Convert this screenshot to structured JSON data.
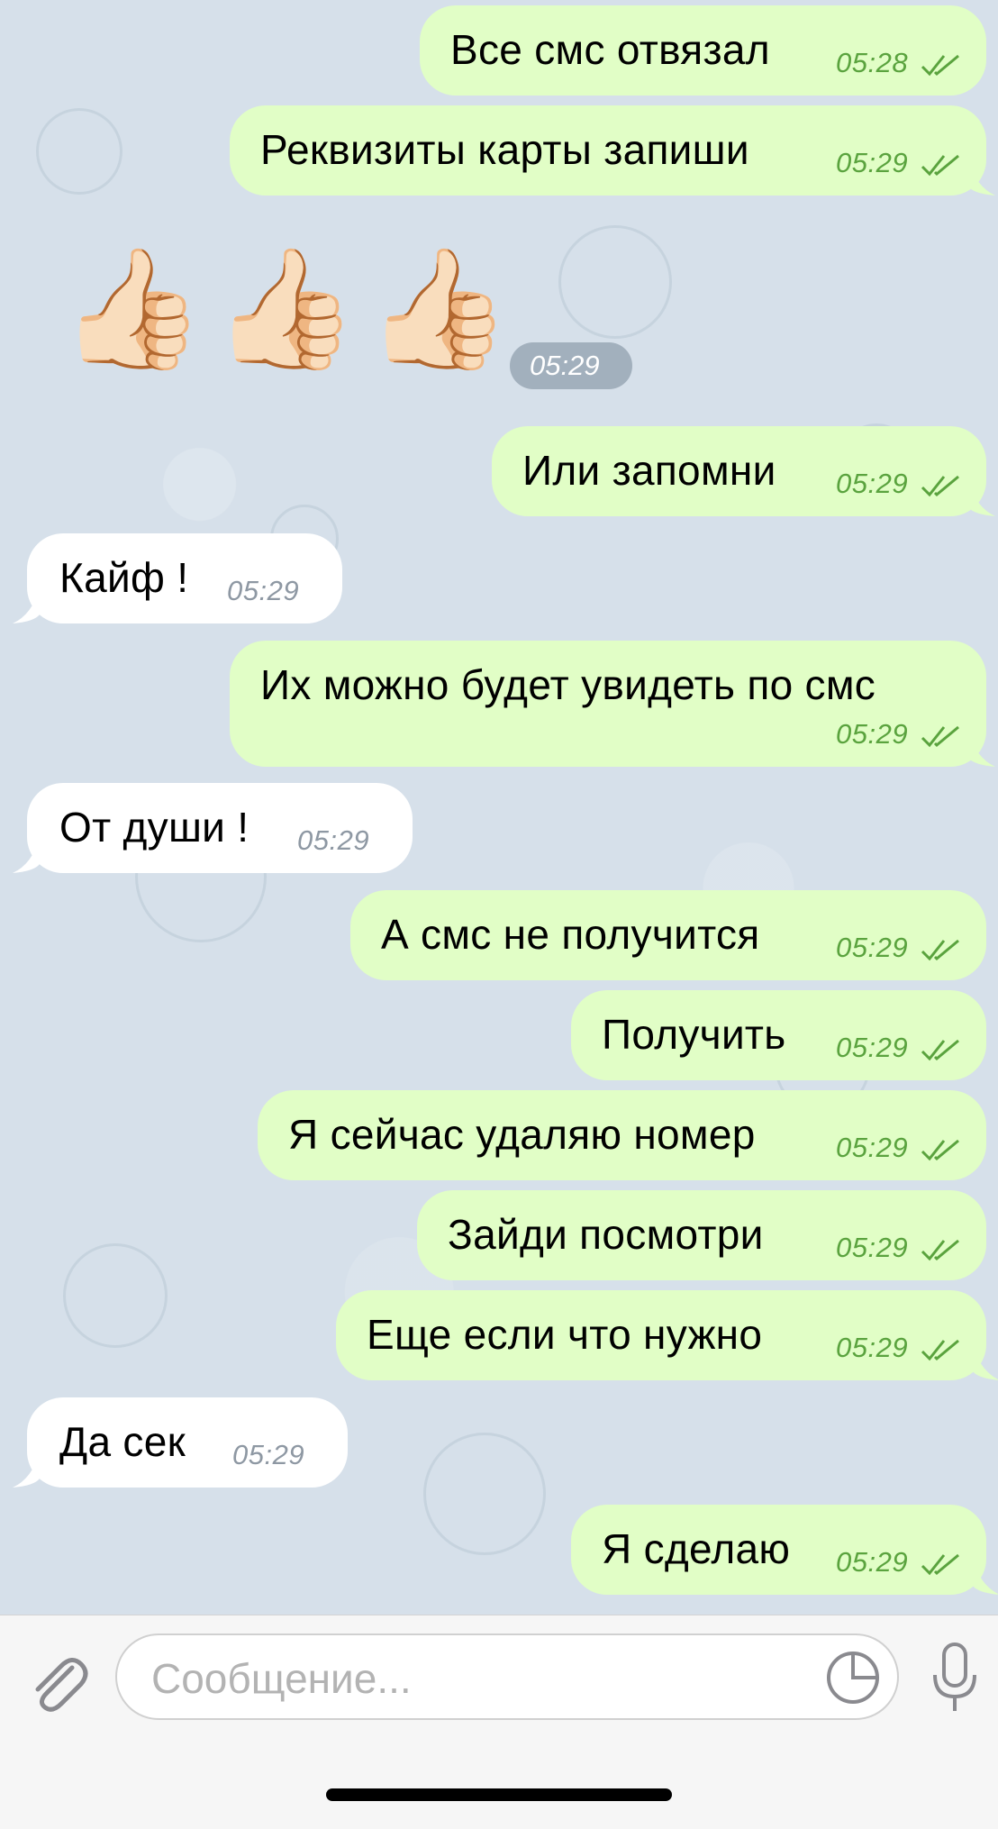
{
  "messages": [
    {
      "dir": "out",
      "text": "Все смс отвязал",
      "time": "05:28"
    },
    {
      "dir": "out",
      "text": "Реквизиты карты запиши",
      "time": "05:29"
    },
    {
      "dir": "sticker",
      "emoji": "👍🏻👍🏻👍🏻",
      "time": "05:29"
    },
    {
      "dir": "out",
      "text": "Или запомни",
      "time": "05:29"
    },
    {
      "dir": "in",
      "text": "Кайф !",
      "time": "05:29"
    },
    {
      "dir": "out",
      "text": "Их можно будет увидеть по смс",
      "time": "05:29"
    },
    {
      "dir": "in",
      "text": "От души !",
      "time": "05:29"
    },
    {
      "dir": "out",
      "text": "А смс не получится",
      "time": "05:29"
    },
    {
      "dir": "out",
      "text": "Получить",
      "time": "05:29"
    },
    {
      "dir": "out",
      "text": "Я сейчас удаляю номер",
      "time": "05:29"
    },
    {
      "dir": "out",
      "text": "Зайди посмотри",
      "time": "05:29"
    },
    {
      "dir": "out",
      "text": "Еще если что нужно",
      "time": "05:29"
    },
    {
      "dir": "in",
      "text": "Да сек",
      "time": "05:29"
    },
    {
      "dir": "out",
      "text": "Я сделаю",
      "time": "05:29"
    }
  ],
  "composer": {
    "placeholder": "Сообщение..."
  },
  "icons": {
    "attach": "paperclip-icon",
    "sticker": "sticker-icon",
    "mic": "microphone-icon"
  },
  "colors": {
    "outgoing_bubble": "#e1fec6",
    "incoming_bubble": "#ffffff",
    "outgoing_time": "#5aa33e",
    "incoming_time": "#8e98a3",
    "chat_background": "#d6e0ea"
  }
}
